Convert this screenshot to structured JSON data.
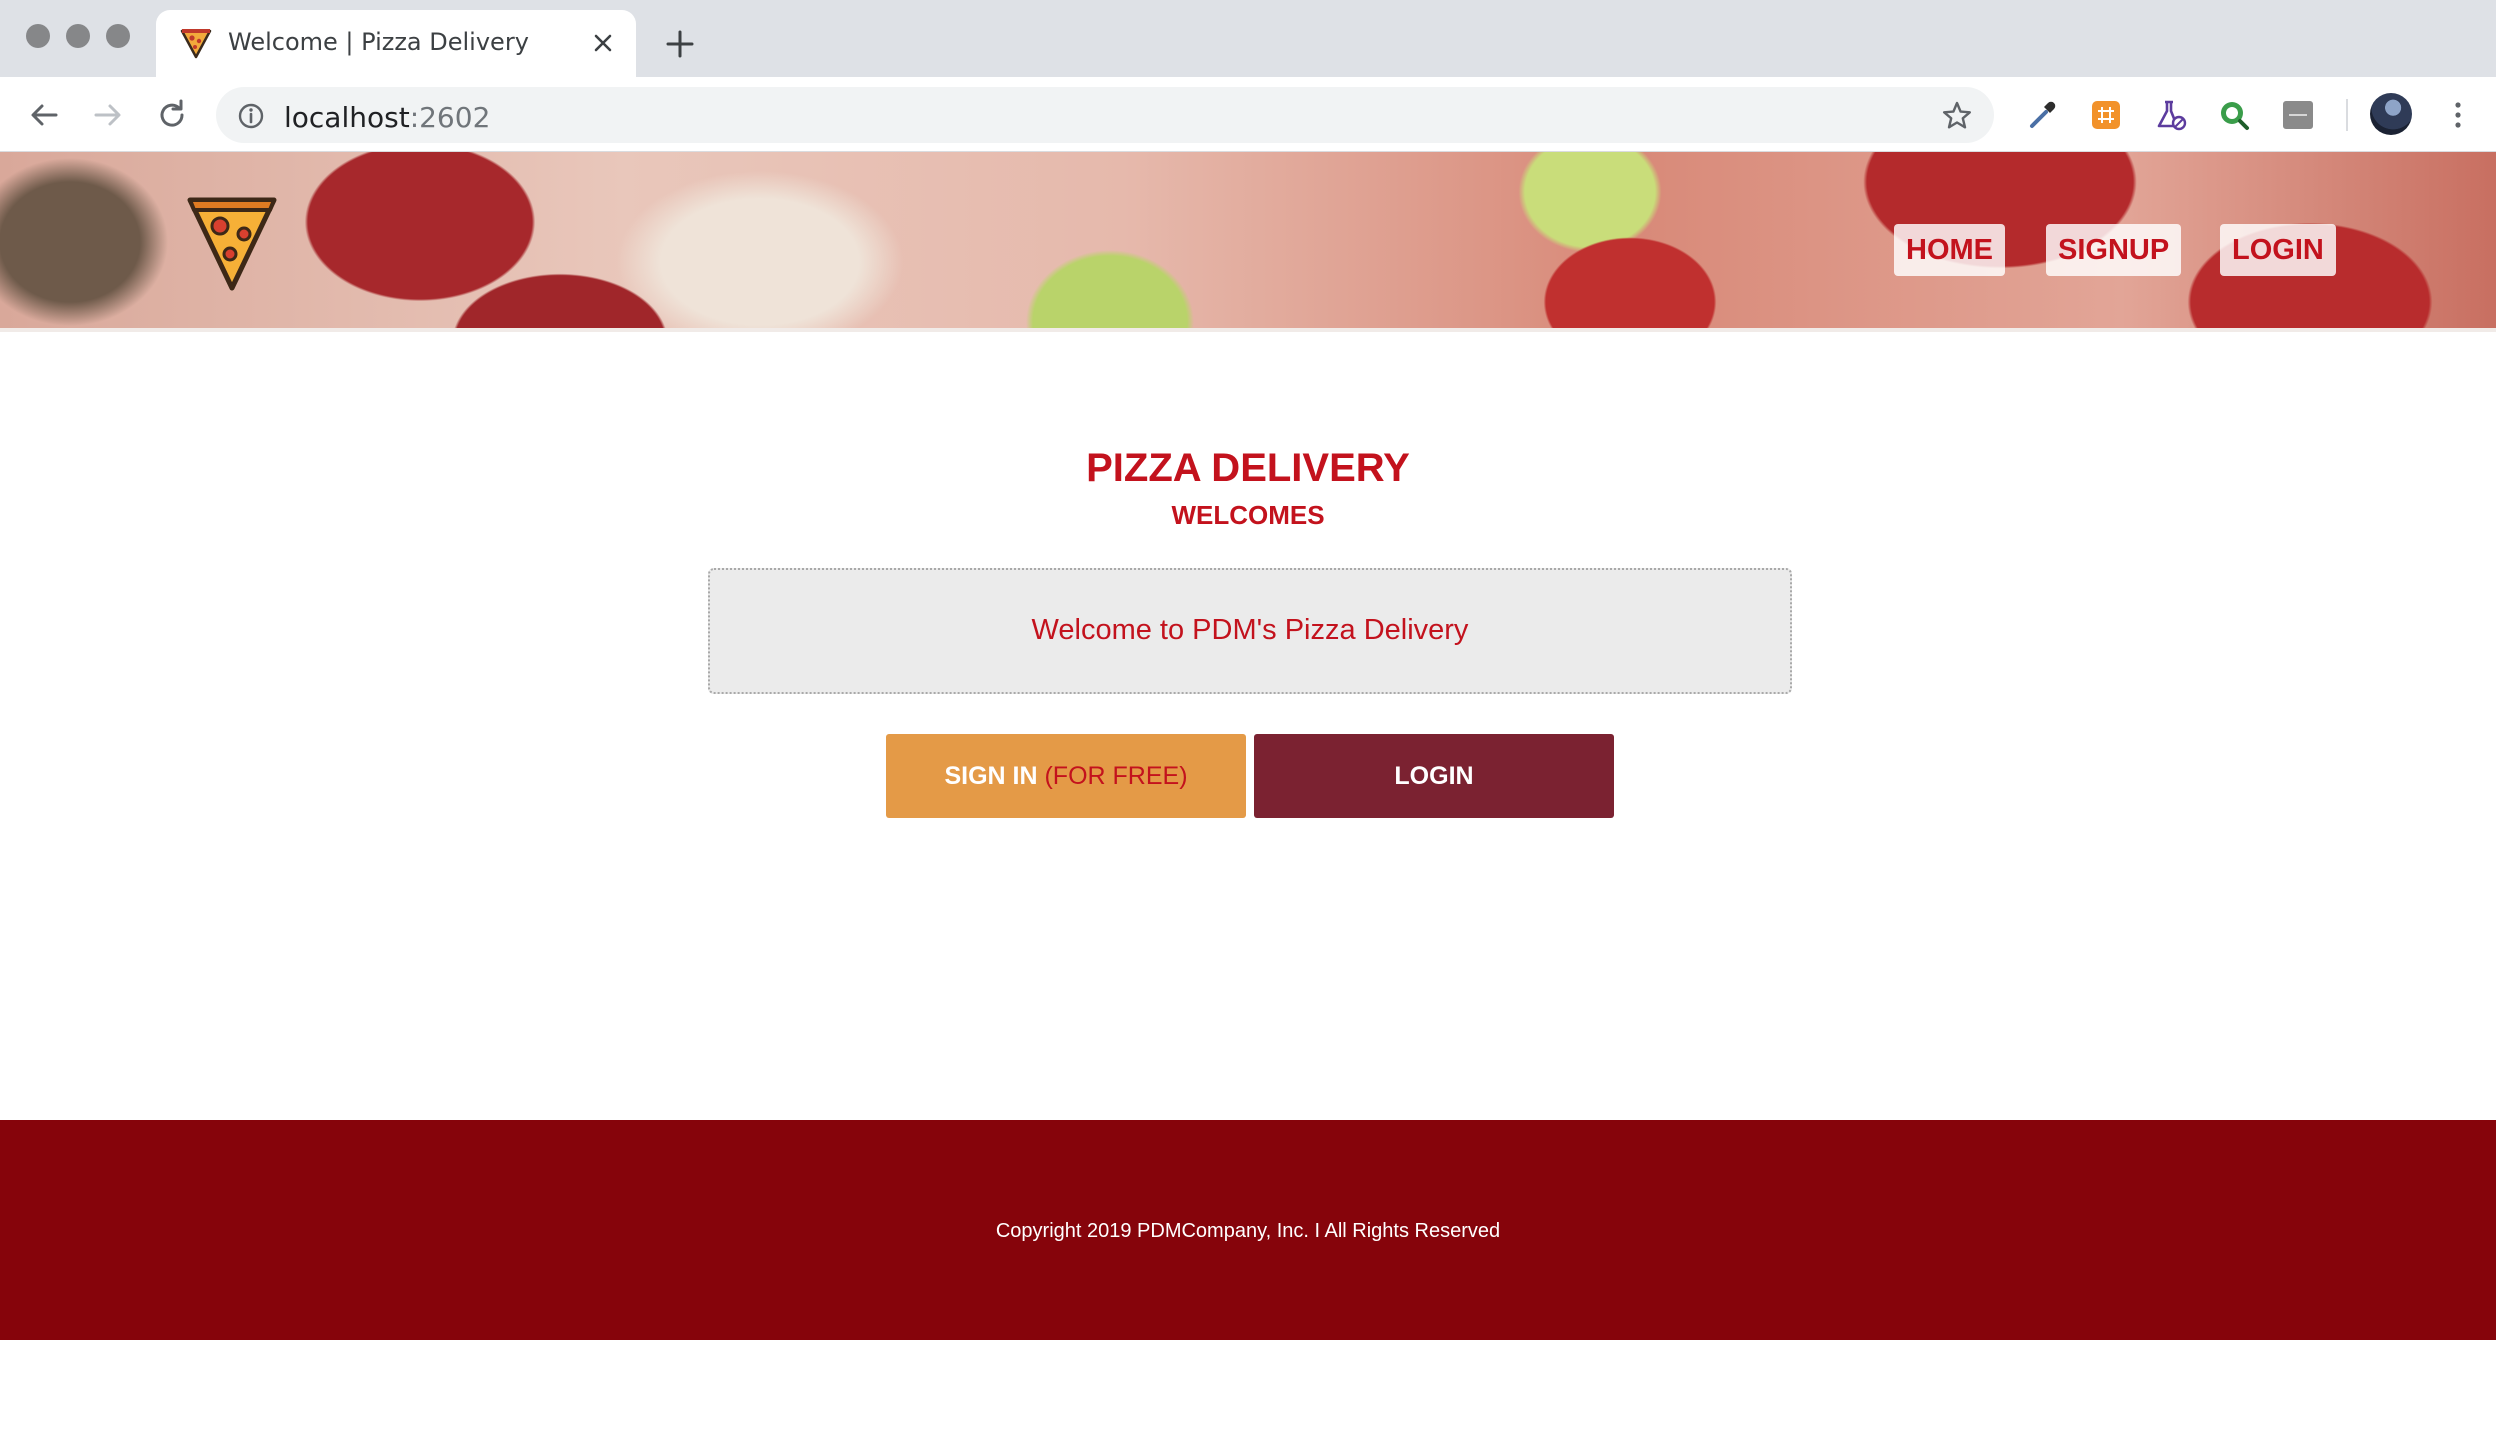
{
  "browser": {
    "tab": {
      "title": "Welcome | Pizza Delivery",
      "favicon": "pizza-slice-icon"
    },
    "url": {
      "host": "localhost",
      "port": ":2602"
    },
    "extensions": [
      "eyedropper-icon",
      "orange-grid-icon",
      "flask-icon",
      "green-search-icon",
      "flow-icon"
    ]
  },
  "header": {
    "logo": "pizza-slice-icon",
    "nav": [
      {
        "label": "HOME"
      },
      {
        "label": "SIGNUP"
      },
      {
        "label": "LOGIN"
      }
    ]
  },
  "main": {
    "title": "PIZZA DELIVERY",
    "subtitle": "WELCOMES",
    "welcome_message": "Welcome to PDM's Pizza Delivery",
    "signin_button": {
      "label": "SIGN IN",
      "suffix": "(FOR FREE)"
    },
    "login_button": {
      "label": "LOGIN"
    }
  },
  "footer": {
    "copyright": "Copyright 2019 PDMCompany, Inc. I All Rights Reserved"
  },
  "colors": {
    "brand_red": "#c3121d",
    "footer_bg": "#86040b",
    "signin_bg": "#e49a47",
    "login_bg": "#7b2231"
  }
}
